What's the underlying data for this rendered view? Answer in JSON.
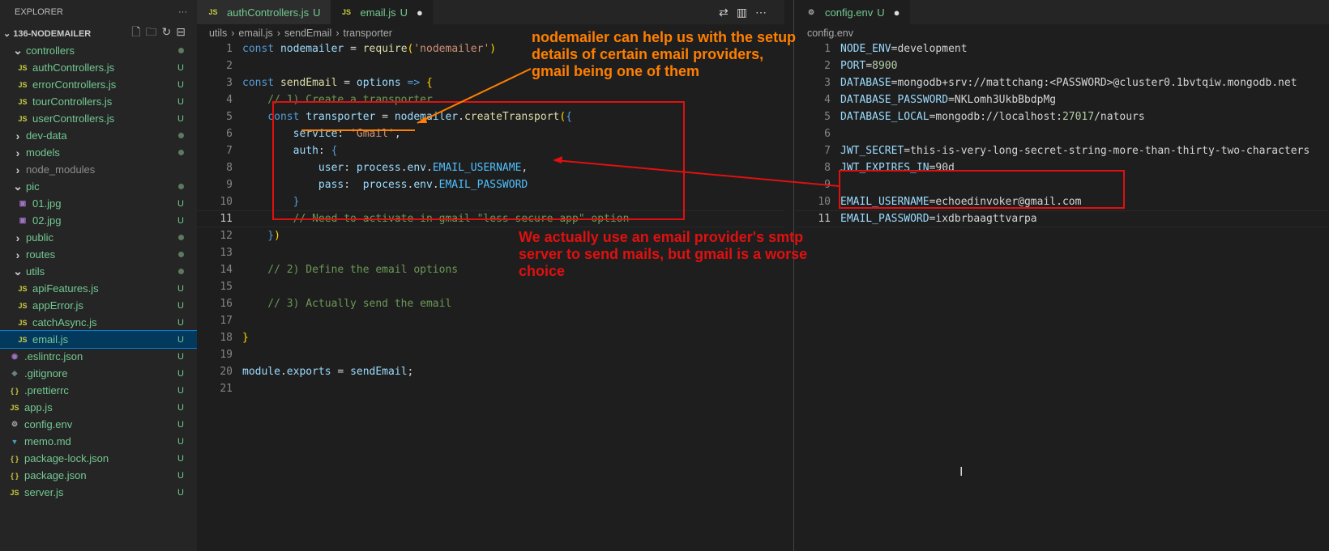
{
  "explorer": {
    "title": "EXPLORER",
    "more": "···",
    "project": "136-NODEMAILER",
    "items": [
      {
        "label": "controllers",
        "type": "folder-open",
        "indent": 1,
        "badge": "dot",
        "color": "green"
      },
      {
        "label": "authControllers.js",
        "type": "js",
        "indent": 2,
        "badge": "U",
        "color": "green"
      },
      {
        "label": "errorControllers.js",
        "type": "js",
        "indent": 2,
        "badge": "U",
        "color": "green"
      },
      {
        "label": "tourControllers.js",
        "type": "js",
        "indent": 2,
        "badge": "U",
        "color": "green"
      },
      {
        "label": "userControllers.js",
        "type": "js",
        "indent": 2,
        "badge": "U",
        "color": "green"
      },
      {
        "label": "dev-data",
        "type": "folder",
        "indent": 1,
        "badge": "dot",
        "color": "green"
      },
      {
        "label": "models",
        "type": "folder",
        "indent": 1,
        "badge": "dot",
        "color": "green"
      },
      {
        "label": "node_modules",
        "type": "folder",
        "indent": 1,
        "badge": "",
        "color": "grey"
      },
      {
        "label": "pic",
        "type": "folder-open",
        "indent": 1,
        "badge": "dot",
        "color": "green"
      },
      {
        "label": "01.jpg",
        "type": "img",
        "indent": 2,
        "badge": "U",
        "color": "green"
      },
      {
        "label": "02.jpg",
        "type": "img",
        "indent": 2,
        "badge": "U",
        "color": "green"
      },
      {
        "label": "public",
        "type": "folder",
        "indent": 1,
        "badge": "dot",
        "color": "green"
      },
      {
        "label": "routes",
        "type": "folder",
        "indent": 1,
        "badge": "dot",
        "color": "green"
      },
      {
        "label": "utils",
        "type": "folder-open",
        "indent": 1,
        "badge": "dot",
        "color": "green"
      },
      {
        "label": "apiFeatures.js",
        "type": "js",
        "indent": 2,
        "badge": "U",
        "color": "green"
      },
      {
        "label": "appError.js",
        "type": "js",
        "indent": 2,
        "badge": "U",
        "color": "green"
      },
      {
        "label": "catchAsync.js",
        "type": "js",
        "indent": 2,
        "badge": "U",
        "color": "green"
      },
      {
        "label": "email.js",
        "type": "js",
        "indent": 2,
        "badge": "U",
        "color": "green",
        "selected": true
      },
      {
        "label": ".eslintrc.json",
        "type": "eslint",
        "indent": 1,
        "badge": "U",
        "color": "green"
      },
      {
        "label": ".gitignore",
        "type": "git",
        "indent": 1,
        "badge": "U",
        "color": "green"
      },
      {
        "label": ".prettierrc",
        "type": "json",
        "indent": 1,
        "badge": "U",
        "color": "green"
      },
      {
        "label": "app.js",
        "type": "js",
        "indent": 1,
        "badge": "U",
        "color": "green"
      },
      {
        "label": "config.env",
        "type": "gear",
        "indent": 1,
        "badge": "U",
        "color": "green"
      },
      {
        "label": "memo.md",
        "type": "md",
        "indent": 1,
        "badge": "U",
        "color": "green"
      },
      {
        "label": "package-lock.json",
        "type": "json",
        "indent": 1,
        "badge": "U",
        "color": "green"
      },
      {
        "label": "package.json",
        "type": "json",
        "indent": 1,
        "badge": "U",
        "color": "green"
      },
      {
        "label": "server.js",
        "type": "js",
        "indent": 1,
        "badge": "U",
        "color": "green"
      }
    ]
  },
  "editor1": {
    "tabs": [
      {
        "label": "authControllers.js",
        "badge": "U"
      },
      {
        "label": "email.js",
        "badge": "U",
        "active": true
      }
    ],
    "breadcrumb": [
      "utils",
      "email.js",
      "sendEmail",
      "transporter"
    ],
    "current_line": 11,
    "lines": [
      [
        [
          "k",
          "const "
        ],
        [
          "v",
          "nodemailer"
        ],
        [
          "p",
          " = "
        ],
        [
          "f",
          "require"
        ],
        [
          "b",
          "("
        ],
        [
          "s",
          "'nodemailer'"
        ],
        [
          "b",
          ")"
        ]
      ],
      [],
      [
        [
          "k",
          "const "
        ],
        [
          "f",
          "sendEmail"
        ],
        [
          "p",
          " = "
        ],
        [
          "v",
          "options"
        ],
        [
          "k",
          " =>"
        ],
        [
          "p",
          " "
        ],
        [
          "b",
          "{"
        ]
      ],
      [
        [
          "c",
          "    // 1) Create a transporter"
        ]
      ],
      [
        [
          "k",
          "    const "
        ],
        [
          "v",
          "transporter"
        ],
        [
          "p",
          " = "
        ],
        [
          "v",
          "nodemailer"
        ],
        [
          "p",
          "."
        ],
        [
          "f",
          "createTransport"
        ],
        [
          "b",
          "("
        ],
        [
          "k",
          "{"
        ]
      ],
      [
        [
          "v",
          "        service"
        ],
        [
          "p",
          ": "
        ],
        [
          "s",
          "'Gmail'"
        ],
        [
          "p",
          ","
        ]
      ],
      [
        [
          "v",
          "        auth"
        ],
        [
          "p",
          ": "
        ],
        [
          "k",
          "{"
        ]
      ],
      [
        [
          "v",
          "            user"
        ],
        [
          "p",
          ": "
        ],
        [
          "v",
          "process"
        ],
        [
          "p",
          "."
        ],
        [
          "v",
          "env"
        ],
        [
          "p",
          "."
        ],
        [
          "cst",
          "EMAIL_USERNAME"
        ],
        [
          "p",
          ","
        ]
      ],
      [
        [
          "v",
          "            pass"
        ],
        [
          "p",
          ":  "
        ],
        [
          "v",
          "process"
        ],
        [
          "p",
          "."
        ],
        [
          "v",
          "env"
        ],
        [
          "p",
          "."
        ],
        [
          "cst",
          "EMAIL_PASSWORD"
        ]
      ],
      [
        [
          "k",
          "        }"
        ]
      ],
      [
        [
          "c",
          "        // Need to activate in gmail \"less secure app\" option"
        ]
      ],
      [
        [
          "k",
          "    }"
        ],
        [
          "b",
          ")"
        ]
      ],
      [],
      [
        [
          "c",
          "    // 2) Define the email options"
        ]
      ],
      [],
      [
        [
          "c",
          "    // 3) Actually send the email"
        ]
      ],
      [],
      [
        [
          "b",
          "}"
        ]
      ],
      [],
      [
        [
          "v",
          "module"
        ],
        [
          "p",
          "."
        ],
        [
          "v",
          "exports"
        ],
        [
          "p",
          " = "
        ],
        [
          "v",
          "sendEmail"
        ],
        [
          "p",
          ";"
        ]
      ],
      []
    ]
  },
  "editor2": {
    "tabs": [
      {
        "label": "config.env",
        "badge": "U",
        "active": true
      }
    ],
    "breadcrumb": [
      "config.env"
    ],
    "current_line": 11,
    "lines": [
      [
        [
          "e",
          "NODE_ENV"
        ],
        [
          "p",
          "=development"
        ]
      ],
      [
        [
          "e",
          "PORT"
        ],
        [
          "p",
          "="
        ],
        [
          "n",
          "8900"
        ]
      ],
      [
        [
          "e",
          "DATABASE"
        ],
        [
          "p",
          "=mongodb+srv://mattchang:<PASSWORD>@cluster0.1bvtqiw.mongodb.net"
        ]
      ],
      [
        [
          "e",
          "DATABASE_PASSWORD"
        ],
        [
          "p",
          "=NKLomh3UkbBbdpMg"
        ]
      ],
      [
        [
          "e",
          "DATABASE_LOCAL"
        ],
        [
          "p",
          "=mongodb://localhost:"
        ],
        [
          "n",
          "27017"
        ],
        [
          "p",
          "/natours"
        ]
      ],
      [],
      [
        [
          "e",
          "JWT_SECRET"
        ],
        [
          "p",
          "=this-is-very-long-secret-string-more-than-thirty-two-characters"
        ]
      ],
      [
        [
          "e",
          "JWT_EXPIRES_IN"
        ],
        [
          "p",
          "=90d"
        ]
      ],
      [],
      [
        [
          "e",
          "EMAIL_USERNAME"
        ],
        [
          "p",
          "=echoedinvoker@gmail.com"
        ]
      ],
      [
        [
          "e",
          "EMAIL_PASSWORD"
        ],
        [
          "p",
          "=ixdbrbaagttvarpa"
        ]
      ]
    ]
  },
  "annotations": {
    "orange": "nodemailer can help us with the setup details of certain email providers, gmail being one of them",
    "red": "We actually use an email provider's smtp server to send mails, but gmail is a worse choice"
  },
  "colors": {
    "orange": "#ff7f00",
    "red": "#e01010",
    "accent": "#007fd4"
  }
}
